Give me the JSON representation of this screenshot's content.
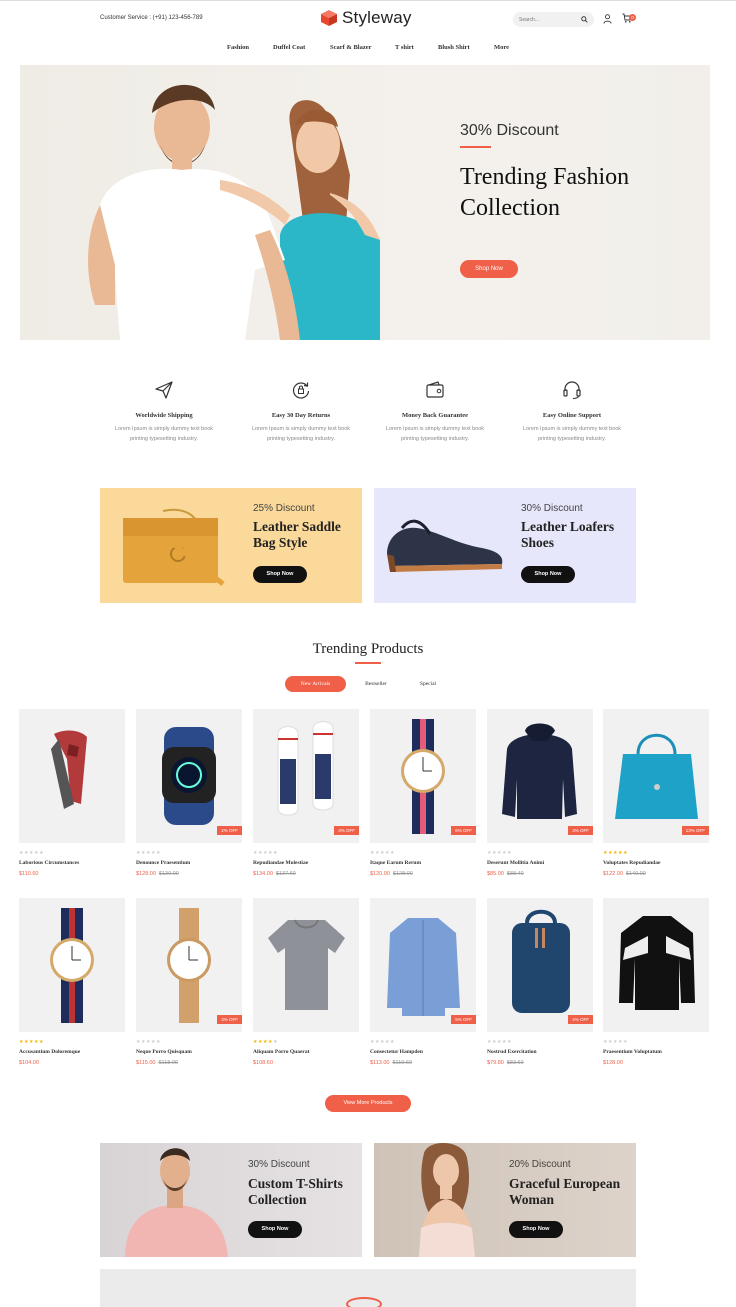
{
  "header": {
    "customer_service": "Customer Service : (+91) 123-456-789",
    "brand": "Styleway",
    "search_placeholder": "Search...",
    "cart_count": "0",
    "nav": [
      "Fashion",
      "Duffel Coat",
      "Scarf & Blazer",
      "T shirt",
      "Blush Shirt",
      "More"
    ]
  },
  "hero": {
    "discount": "30% Discount",
    "title_line1": "Trending Fashion",
    "title_line2": "Collection",
    "button": "Shop Now"
  },
  "features": [
    {
      "title": "Worldwide Shipping",
      "desc1": "Lorem Ipsum is simply dummy text book",
      "desc2": "printing typesetting industry.",
      "icon": "paper-plane-icon"
    },
    {
      "title": "Easy 30 Day Returns",
      "desc1": "Lorem Ipsum is simply dummy text book",
      "desc2": "printing typesetting industry.",
      "icon": "return-icon"
    },
    {
      "title": "Money Back Guarantee",
      "desc1": "Lorem Ipsum is simply dummy text book",
      "desc2": "printing typesetting industry.",
      "icon": "wallet-icon"
    },
    {
      "title": "Easy Online Support",
      "desc1": "Lorem Ipsum is simply dummy text book",
      "desc2": "printing typesetting industry.",
      "icon": "headset-icon"
    }
  ],
  "banners": [
    {
      "discount": "25% Discount",
      "title1": "Leather Saddle",
      "title2": "Bag Style",
      "button": "Shop Now",
      "bg": "#fbd99a"
    },
    {
      "discount": "30% Discount",
      "title1": "Leather Loafers",
      "title2": "Shoes",
      "button": "Shop Now",
      "bg": "#e6e7fb"
    }
  ],
  "trending": {
    "title": "Trending Products",
    "tabs": [
      "New Arrivals",
      "Bestseller",
      "Special"
    ],
    "active_tab": "New Arrivals",
    "more_button": "View More Products"
  },
  "products": [
    {
      "name": "Laborious Circumstances",
      "price": "$110.60",
      "old": "",
      "off": "",
      "rating": 0
    },
    {
      "name": "Denounce Praesentium",
      "price": "$128.00",
      "old": "$130.00",
      "off": "2% OFF",
      "rating": 0
    },
    {
      "name": "Repudiandae Molestiae",
      "price": "$134.00",
      "old": "$137.60",
      "off": "3% OFF",
      "rating": 0
    },
    {
      "name": "Itaque Earum Rerum",
      "price": "$120.00",
      "old": "$128.00",
      "off": "6% OFF",
      "rating": 0
    },
    {
      "name": "Deserunt Mollitia Animi",
      "price": "$85.00",
      "old": "$88.40",
      "off": "3% OFF",
      "rating": 0
    },
    {
      "name": "Voluptates Repudiandae",
      "price": "$122.00",
      "old": "$140.00",
      "off": "13% OFF",
      "rating": 5
    },
    {
      "name": "Accusantium Doloremque",
      "price": "$104.00",
      "old": "",
      "off": "",
      "rating": 5
    },
    {
      "name": "Neque Porro Quisquam",
      "price": "$115.00",
      "old": "$118.00",
      "off": "3% OFF",
      "rating": 0
    },
    {
      "name": "Aliquam Porro Quaerat",
      "price": "$108.60",
      "old": "",
      "off": "",
      "rating": 4
    },
    {
      "name": "Consectetur Hampden",
      "price": "$113.00",
      "old": "$119.60",
      "off": "5% OFF",
      "rating": 0
    },
    {
      "name": "Nostrud Exercitation",
      "price": "$79.80",
      "old": "$83.60",
      "off": "4% OFF",
      "rating": 0
    },
    {
      "name": "Praesentium Voluptatum",
      "price": "$128.00",
      "old": "",
      "off": "",
      "rating": 0
    }
  ],
  "promos": [
    {
      "discount": "30% Discount",
      "title1": "Custom T-Shirts",
      "title2": "Collection",
      "button": "Shop Now"
    },
    {
      "discount": "20% Discount",
      "title1": "Graceful European",
      "title2": "Woman",
      "button": "Shop Now"
    }
  ],
  "colors": {
    "accent": "#f05f47",
    "dark": "#111111"
  }
}
